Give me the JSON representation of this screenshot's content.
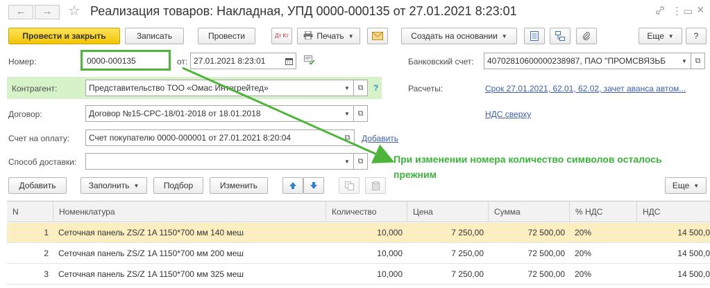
{
  "window": {
    "title": "Реализация товаров: Накладная, УПД 0000-000135 от 27.01.2021 8:23:01",
    "back_icon": "←",
    "forward_icon": "→",
    "favorite_icon": "☆",
    "link_icon": "🔗",
    "more_icon": "⋮",
    "restore_icon": "▭",
    "close_icon": "×"
  },
  "toolbar": {
    "post_and_close": "Провести и закрыть",
    "save": "Записать",
    "post": "Провести",
    "dt_kt": "Дт Кт",
    "print": "Печать",
    "create_based_on": "Создать на основании",
    "more": "Еще",
    "help": "?"
  },
  "form": {
    "number_label": "Номер:",
    "number_value": "0000-000135",
    "date_label": "от:",
    "date_value": "27.01.2021  8:23:01",
    "bank_label": "Банковский счет:",
    "bank_value": "40702810600000238987, ПАО \"ПРОМСВЯЗЬБ",
    "contractor_label": "Контрагент:",
    "contractor_value": "Представительство ТОО «Омас Интегрейтед»",
    "contractor_help": "?",
    "settlements_label": "Расчеты:",
    "settlements_link": "Срок 27.01.2021, 62.01, 62.02, зачет аванса автом...",
    "contract_label": "Договор:",
    "contract_value": "Договор №15-CPC-18/01-2018 от 18.01.2018",
    "vat_link": "НДС сверху",
    "invoice_label": "Счет на оплату:",
    "invoice_value": "Счет покупателю 0000-000001 от 27.01.2021 8:20:04",
    "invoice_add": "Добавить",
    "delivery_label": "Способ доставки:",
    "delivery_value": ""
  },
  "annotation": {
    "line1": "При изменении номера количество символов осталось",
    "line2": "прежним",
    "color": "#3cb23c"
  },
  "table_toolbar": {
    "add": "Добавить",
    "fill": "Заполнить",
    "selection": "Подбор",
    "change": "Изменить",
    "more": "Еще"
  },
  "table": {
    "columns": [
      "N",
      "Номенклатура",
      "Количество",
      "Цена",
      "Сумма",
      "% НДС",
      "НДС"
    ],
    "rows": [
      {
        "n": "1",
        "item": "Сеточная панель ZS/Z 1A 1150*700 мм 140 меш",
        "qty": "10,000",
        "price": "7 250,00",
        "sum": "72 500,00",
        "vat_rate": "20%",
        "vat": "14 500,0"
      },
      {
        "n": "2",
        "item": "Сеточная панель ZS/Z 1A 1150*700 мм 200 меш",
        "qty": "10,000",
        "price": "7 250,00",
        "sum": "72 500,00",
        "vat_rate": "20%",
        "vat": "14 500,0"
      },
      {
        "n": "3",
        "item": "Сеточная панель ZS/Z 1A 1150*700 мм 325 меш",
        "qty": "10,000",
        "price": "7 250,00",
        "sum": "72 500,00",
        "vat_rate": "20%",
        "vat": "14 500,0"
      }
    ]
  },
  "colors": {
    "primary_button": "#f2c406",
    "highlight_border": "#4fb53a",
    "contractor_band": "#d6f2c8",
    "selected_row": "#fbeec0",
    "link": "#3f5ea8"
  }
}
